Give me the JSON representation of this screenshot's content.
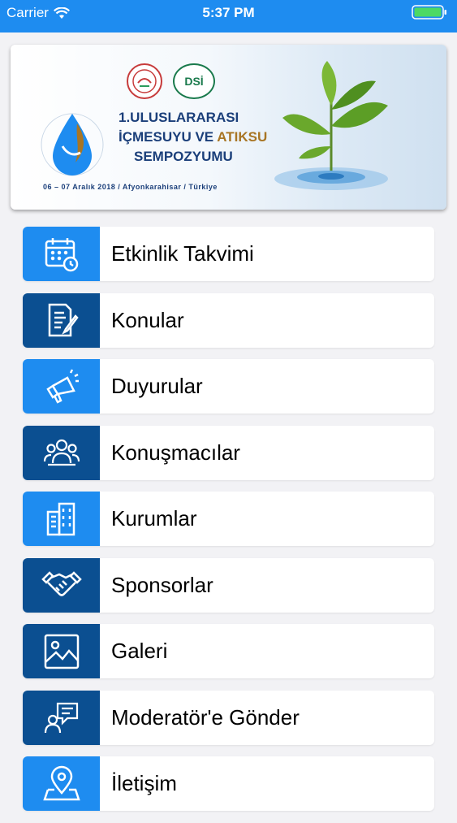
{
  "status_bar": {
    "carrier": "Carrier",
    "time": "5:37 PM"
  },
  "banner": {
    "logo_text": "DSİ",
    "title_line1": "1.ULUSLARARASI",
    "title_line2_a": "İÇMESUYU VE",
    "title_line2_b": "ATIKSU",
    "title_line3": "SEMPOZYUMU",
    "date_line": "06 – 07 Aralık 2018 / Afyonkarahisar / Türkiye"
  },
  "menu": {
    "items": [
      {
        "label": "Etkinlik Takvimi",
        "icon": "calendar-icon"
      },
      {
        "label": "Konular",
        "icon": "document-edit-icon"
      },
      {
        "label": "Duyurular",
        "icon": "megaphone-icon"
      },
      {
        "label": "Konuşmacılar",
        "icon": "group-icon"
      },
      {
        "label": "Kurumlar",
        "icon": "building-icon"
      },
      {
        "label": "Sponsorlar",
        "icon": "handshake-icon"
      },
      {
        "label": "Galeri",
        "icon": "image-icon"
      },
      {
        "label": "Moderatör'e Gönder",
        "icon": "speech-bubble-icon"
      },
      {
        "label": "İletişim",
        "icon": "map-pin-icon"
      }
    ]
  },
  "colors": {
    "accent_light": "#1e8cf0",
    "accent_dark": "#0b4f91",
    "background": "#f2f2f5"
  }
}
